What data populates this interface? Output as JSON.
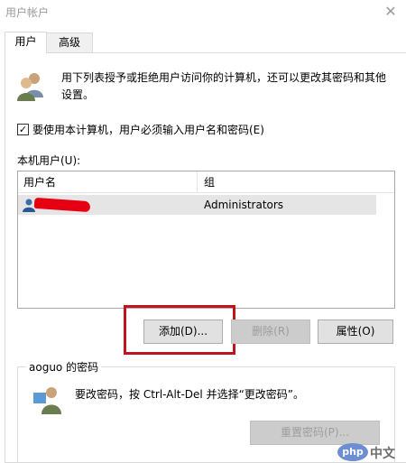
{
  "window": {
    "title": "用户帐户",
    "close_glyph": "✕"
  },
  "tabs": [
    {
      "label": "用户",
      "active": true
    },
    {
      "label": "高级",
      "active": false
    }
  ],
  "description": "用下列表授予或拒绝用户访问你的计算机，还可以更改其密码和其他设置。",
  "must_login_checkbox": {
    "checked": true,
    "label": "要使用本计算机，用户必须输入用户名和密码(E)"
  },
  "user_list": {
    "label": "本机用户(U):",
    "columns": [
      "用户名",
      "组"
    ],
    "rows": [
      {
        "username_redacted": true,
        "group": "Administrators"
      }
    ]
  },
  "buttons": {
    "add": "添加(D)...",
    "remove": "删除(R)",
    "properties": "属性(O)"
  },
  "password_group": {
    "title": "aoguo 的密码",
    "text": "要改密码，按 Ctrl-Alt-Del 并选择“更改密码”。",
    "reset_button": "重置密码(P)..."
  },
  "watermark": {
    "logo_text": "php",
    "site_text": "中文网"
  },
  "colors": {
    "highlight_red": "#c0141e",
    "redaction_red": "#e60012",
    "selected_row": "#e5e5e5",
    "disabled_text": "#9d9d9d"
  }
}
